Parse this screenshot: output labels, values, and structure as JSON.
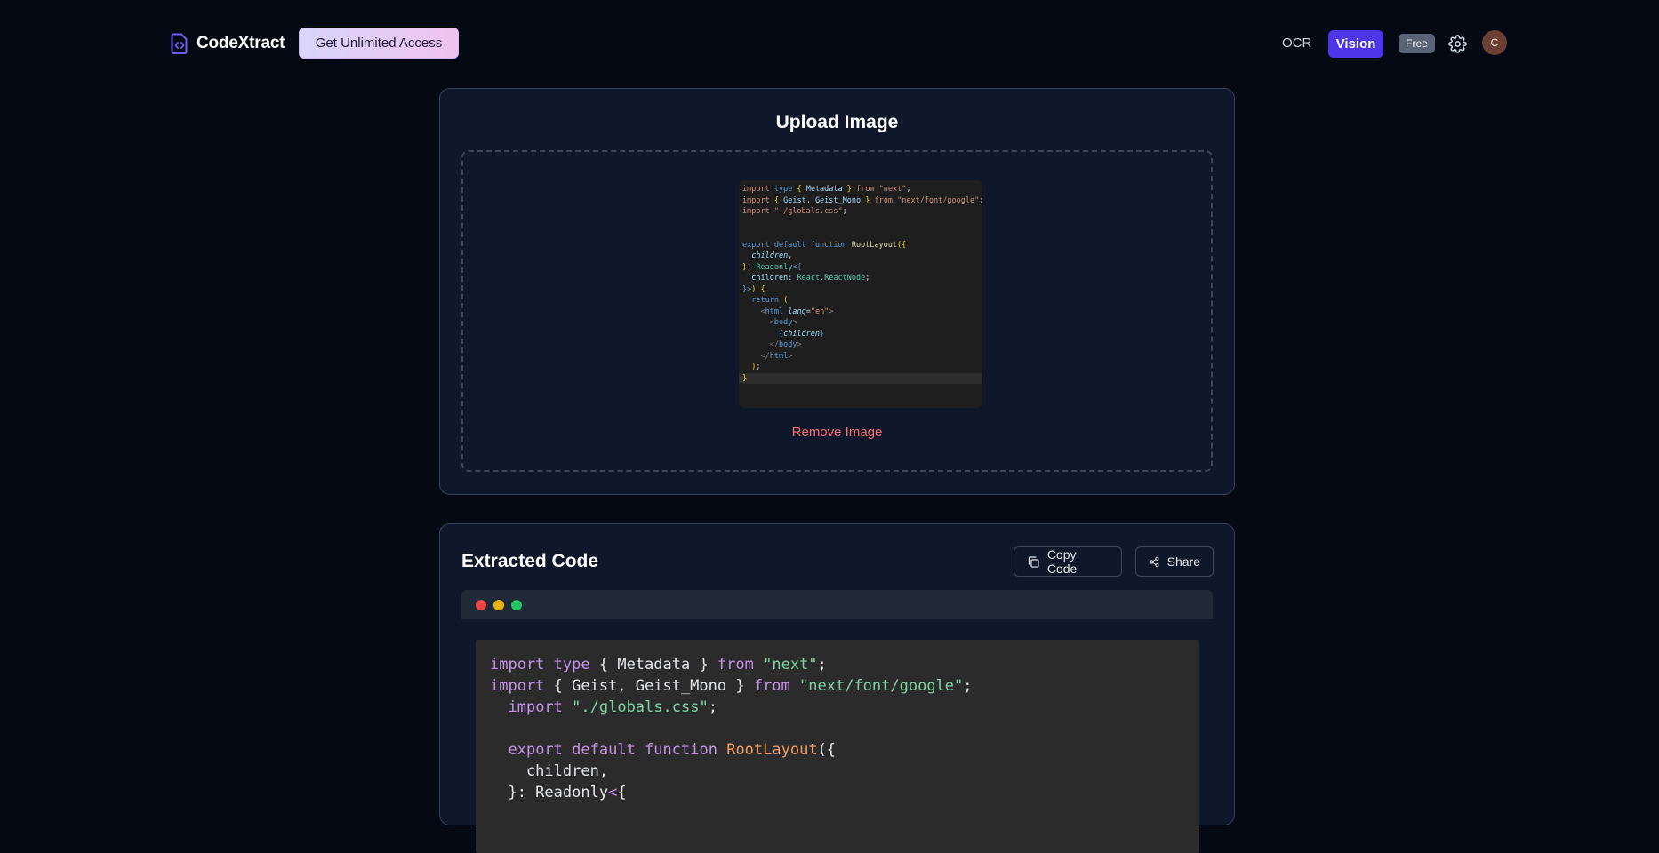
{
  "header": {
    "app_name": "CodeXtract",
    "unlimited_label": "Get Unlimited Access",
    "nav_ocr": "OCR",
    "nav_vision": "Vision",
    "plan_badge": "Free",
    "avatar_initial": "C"
  },
  "upload": {
    "title": "Upload Image",
    "remove_label": "Remove Image",
    "preview_lines": [
      "import type { Metadata } from \"next\";",
      "import { Geist, Geist_Mono } from \"next/font/google\";",
      "import \"./globals.css\";",
      "",
      "",
      "export default function RootLayout({",
      "  children,",
      "}: Readonly<{",
      "  children: React.ReactNode;",
      "}>) {",
      "  return (",
      "    <html lang=\"en\">",
      "      <body>",
      "        {children}",
      "      </body>",
      "    </html>",
      "  );",
      "}"
    ]
  },
  "extracted": {
    "title": "Extracted Code",
    "copy_label": "Copy Code",
    "share_label": "Share",
    "code_lines": [
      "import type { Metadata } from \"next\";",
      "import { Geist, Geist_Mono } from \"next/font/google\";",
      "  import \"./globals.css\";",
      "",
      "  export default function RootLayout({",
      "    children,",
      "  }: Readonly<{"
    ]
  },
  "colors": {
    "background": "#050914",
    "card": "#0f172a",
    "accent": "#4f35e8",
    "danger": "#f87171"
  }
}
